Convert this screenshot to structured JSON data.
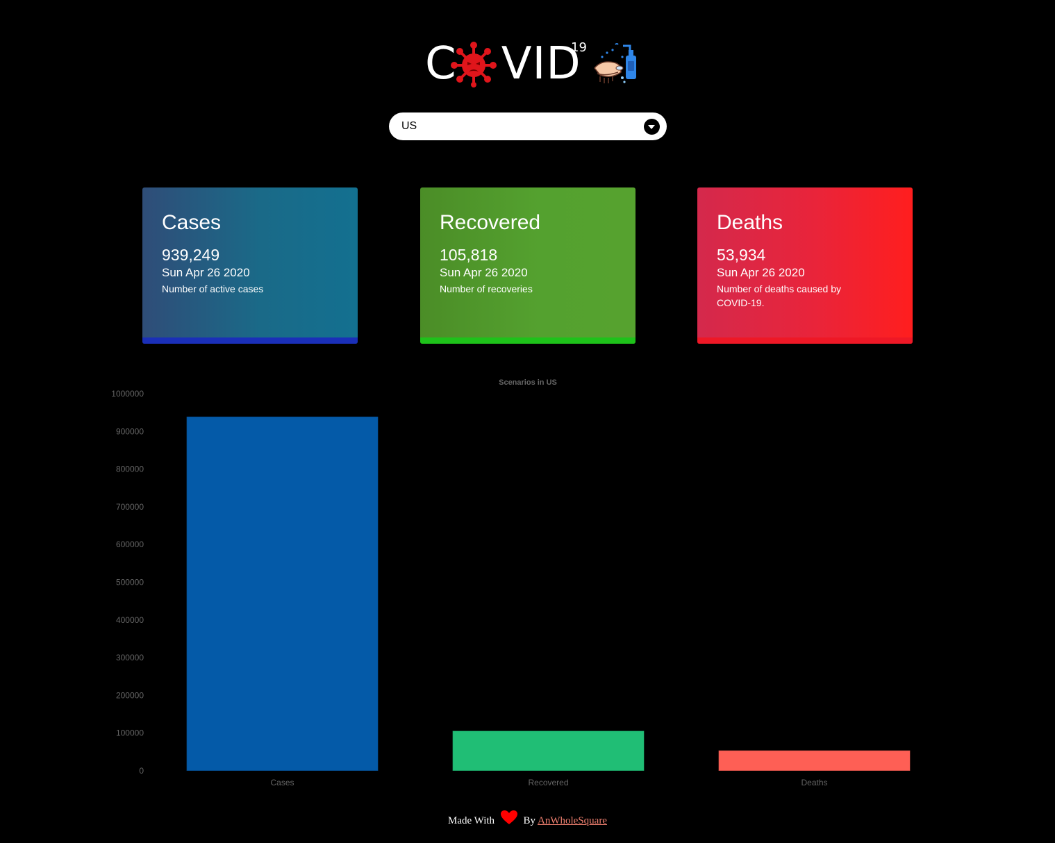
{
  "header": {
    "logo_text": "C VID",
    "logo_superscript": "19",
    "virus_icon": "virus-icon",
    "handwash_icon": "handwash-sanitizer-icon"
  },
  "country_select": {
    "value": "US",
    "icon": "chevron-down-circle-icon"
  },
  "cards": {
    "cases": {
      "title": "Cases",
      "value": "939,249",
      "date": "Sun Apr 26 2020",
      "description": "Number of active cases",
      "accent": "#1a2fb8"
    },
    "recovered": {
      "title": "Recovered",
      "value": "105,818",
      "date": "Sun Apr 26 2020",
      "description": "Number of recoveries",
      "accent": "#1ec21a"
    },
    "deaths": {
      "title": "Deaths",
      "value": "53,934",
      "date": "Sun Apr 26 2020",
      "description": "Number of deaths caused by COVID-19.",
      "accent": "#ee1826"
    }
  },
  "chart_data": {
    "type": "bar",
    "title": "Scenarios in US",
    "categories": [
      "Cases",
      "Recovered",
      "Deaths"
    ],
    "values": [
      939249,
      105818,
      53934
    ],
    "colors": [
      "#045aa8",
      "#20be75",
      "#fe5f55"
    ],
    "ylim": [
      0,
      1000000
    ],
    "yticks": [
      0,
      100000,
      200000,
      300000,
      400000,
      500000,
      600000,
      700000,
      800000,
      900000,
      1000000
    ],
    "grid": false,
    "legend": "none"
  },
  "footer": {
    "made_with": "Made With",
    "by": "By",
    "author": "AnWholeSquare",
    "heart_color": "#ff0000"
  }
}
